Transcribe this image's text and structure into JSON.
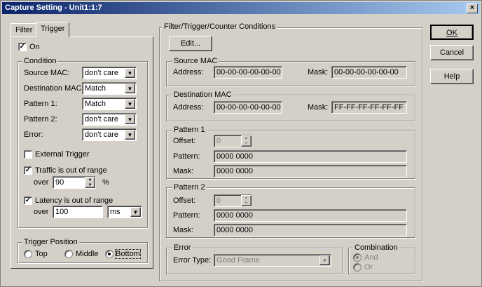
{
  "window": {
    "title": "Capture Setting - Unit1:1:7",
    "close_glyph": "×"
  },
  "tabs": [
    {
      "label": "Filter"
    },
    {
      "label": "Trigger"
    }
  ],
  "trigger": {
    "on_label": "On",
    "condition": {
      "title": "Condition",
      "source_mac": {
        "label": "Source MAC:",
        "value": "don't care"
      },
      "destination_mac": {
        "label": "Destination MAC:",
        "value": "Match"
      },
      "pattern1": {
        "label": "Pattern 1:",
        "value": "Match"
      },
      "pattern2": {
        "label": "Pattern 2:",
        "value": "don't care"
      },
      "error": {
        "label": "Error:",
        "value": "don't care"
      },
      "external_trigger": "External Trigger",
      "traffic": {
        "label": "Traffic is out of range",
        "over": "over",
        "value": "90",
        "unit": "%"
      },
      "latency": {
        "label": "Latency is out of range",
        "over": "over",
        "value": "100",
        "unit": "ms"
      }
    },
    "position": {
      "title": "Trigger Position",
      "top": "Top",
      "middle": "Middle",
      "bottom": "Bottom"
    }
  },
  "conditions": {
    "title": "Filter/Trigger/Counter Conditions",
    "edit_button": "Edit...",
    "source_mac": {
      "title": "Source MAC",
      "address_label": "Address:",
      "address": "00-00-00-00-00-00",
      "mask_label": "Mask:",
      "mask": "00-00-00-00-00-00"
    },
    "destination_mac": {
      "title": "Destination MAC",
      "address_label": "Address:",
      "address": "00-00-00-00-00-00",
      "mask_label": "Mask:",
      "mask": "FF-FF-FF-FF-FF-FF"
    },
    "pattern1": {
      "title": "Pattern 1",
      "offset_label": "Offset:",
      "offset": "0",
      "pattern_label": "Pattern:",
      "pattern": "0000 0000",
      "mask_label": "Mask:",
      "mask": "0000 0000"
    },
    "pattern2": {
      "title": "Pattern 2",
      "offset_label": "Offset:",
      "offset": "0",
      "pattern_label": "Pattern:",
      "pattern": "0000 0000",
      "mask_label": "Mask:",
      "mask": "0000 0000"
    },
    "error": {
      "title": "Error",
      "type_label": "Error Type:",
      "type_value": "Good Frame"
    },
    "combination": {
      "title": "Combination",
      "and": "And",
      "or": "Or"
    }
  },
  "buttons": {
    "ok": "OK",
    "cancel": "Cancel",
    "help": "Help"
  }
}
